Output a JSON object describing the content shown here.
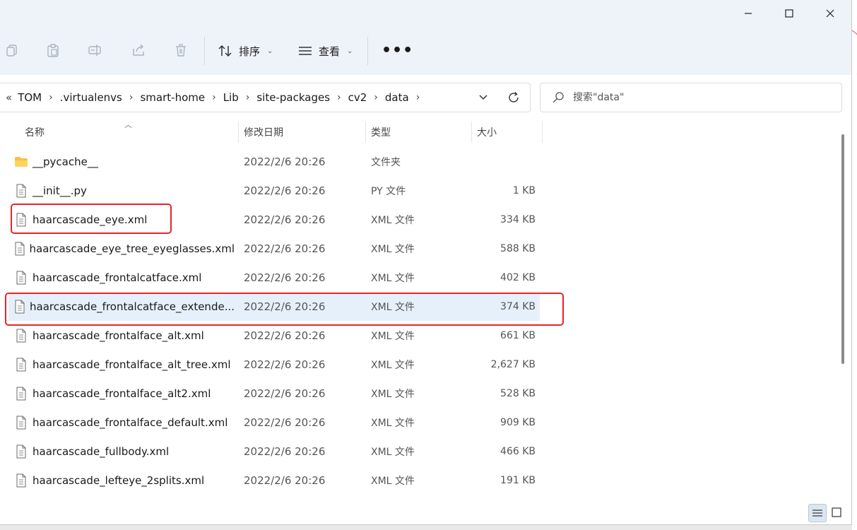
{
  "window": {
    "accent": "#1a73e8"
  },
  "toolbar": {
    "sort_label": "排序",
    "view_label": "查看",
    "more_label": "•••"
  },
  "address": {
    "overflow_label": "«",
    "crumbs": [
      "TOM",
      ".virtualenvs",
      "smart-home",
      "Lib",
      "site-packages",
      "cv2",
      "data"
    ]
  },
  "search": {
    "placeholder": "搜索\"data\""
  },
  "columns": {
    "name": "名称",
    "modified": "修改日期",
    "type": "类型",
    "size": "大小"
  },
  "files": [
    {
      "name": "__pycache__",
      "modified": "2022/2/6 20:26",
      "type": "文件夹",
      "size": "",
      "icon": "folder-icon"
    },
    {
      "name": "__init__.py",
      "modified": "2022/2/6 20:26",
      "type": "PY 文件",
      "size": "1 KB",
      "icon": "file-icon"
    },
    {
      "name": "haarcascade_eye.xml",
      "modified": "2022/2/6 20:26",
      "type": "XML 文件",
      "size": "334 KB",
      "icon": "file-icon"
    },
    {
      "name": "haarcascade_eye_tree_eyeglasses.xml",
      "modified": "2022/2/6 20:26",
      "type": "XML 文件",
      "size": "588 KB",
      "icon": "file-icon"
    },
    {
      "name": "haarcascade_frontalcatface.xml",
      "modified": "2022/2/6 20:26",
      "type": "XML 文件",
      "size": "402 KB",
      "icon": "file-icon"
    },
    {
      "name": "haarcascade_frontalcatface_extende...",
      "modified": "2022/2/6 20:26",
      "type": "XML 文件",
      "size": "374 KB",
      "icon": "file-icon"
    },
    {
      "name": "haarcascade_frontalface_alt.xml",
      "modified": "2022/2/6 20:26",
      "type": "XML 文件",
      "size": "661 KB",
      "icon": "file-icon"
    },
    {
      "name": "haarcascade_frontalface_alt_tree.xml",
      "modified": "2022/2/6 20:26",
      "type": "XML 文件",
      "size": "2,627 KB",
      "icon": "file-icon"
    },
    {
      "name": "haarcascade_frontalface_alt2.xml",
      "modified": "2022/2/6 20:26",
      "type": "XML 文件",
      "size": "528 KB",
      "icon": "file-icon"
    },
    {
      "name": "haarcascade_frontalface_default.xml",
      "modified": "2022/2/6 20:26",
      "type": "XML 文件",
      "size": "909 KB",
      "icon": "file-icon"
    },
    {
      "name": "haarcascade_fullbody.xml",
      "modified": "2022/2/6 20:26",
      "type": "XML 文件",
      "size": "466 KB",
      "icon": "file-icon"
    },
    {
      "name": "haarcascade_lefteye_2splits.xml",
      "modified": "2022/2/6 20:26",
      "type": "XML 文件",
      "size": "191 KB",
      "icon": "file-icon"
    }
  ],
  "annotation_color": "#e8232a",
  "selection_color": "#e6f0fb"
}
